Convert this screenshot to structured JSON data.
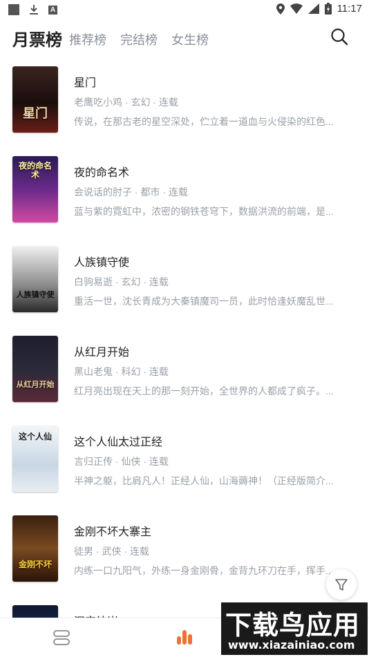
{
  "status": {
    "time": "11:17",
    "app_badge": "A"
  },
  "header": {
    "active_tab": "月票榜",
    "tabs": [
      "推荐榜",
      "完结榜",
      "女生榜"
    ]
  },
  "books": [
    {
      "title": "星门",
      "meta": "老鹰吃小鸡 · 玄幻 · 连载",
      "desc": "传说，在那古老的星空深处，伫立着一道血与火侵染的红色...",
      "cover_text": "星门",
      "cover_colors": [
        "#2a1c1a",
        "#7a2a20"
      ]
    },
    {
      "title": "夜的命名术",
      "meta": "会说话的肘子 · 都市 · 连载",
      "desc": "蓝与紫的霓虹中，浓密的钢铁苍穹下，数据洪流的前端，是...",
      "cover_text": "夜的命名术",
      "cover_colors": [
        "#3a1a5a",
        "#c04a9a"
      ]
    },
    {
      "title": "人族镇守使",
      "meta": "白驹易逝 · 玄幻 · 连载",
      "desc": "重活一世，沈长青成为大秦镇魔司一员，此时恰逢妖魔乱世...",
      "cover_text": "人族镇守使",
      "cover_colors": [
        "#d8d8d8",
        "#3a3a3a"
      ]
    },
    {
      "title": "从红月开始",
      "meta": "黑山老鬼 · 科幻 · 连载",
      "desc": "红月亮出现在天上的那一刻开始，全世界的人都成了疯子。...",
      "cover_text": "从红月开始",
      "cover_colors": [
        "#1a1a2a",
        "#6a3040"
      ]
    },
    {
      "title": "这个人仙太过正经",
      "meta": "言归正传 · 仙侠 · 连载",
      "desc": "半神之躯，比肩凡人！正经人仙，山海薅神！（正经版简介...",
      "cover_text": "这个人仙",
      "cover_colors": [
        "#e8eef4",
        "#9ab0c8"
      ]
    },
    {
      "title": "金刚不坏大寨主",
      "meta": "徒男 · 武侠 · 连载",
      "desc": "内练一口九阳气，外练一身金刚骨，金背九环刀在手，挥手...",
      "cover_text": "金刚不坏",
      "cover_colors": [
        "#2a1a10",
        "#c07020"
      ]
    },
    {
      "title": "深空彼岸",
      "meta": "",
      "desc": "",
      "cover_text": "",
      "cover_colors": [
        "#101828",
        "#2a3a6a"
      ]
    }
  ],
  "watermark": {
    "line1": "下载鸟应用",
    "line2": "www.xiazainiao.com"
  },
  "colors": {
    "accent": "#f07030",
    "muted": "#9aa0a8"
  },
  "icons": [
    "search-icon",
    "filter-icon",
    "bookshelf-icon",
    "ranking-icon"
  ]
}
